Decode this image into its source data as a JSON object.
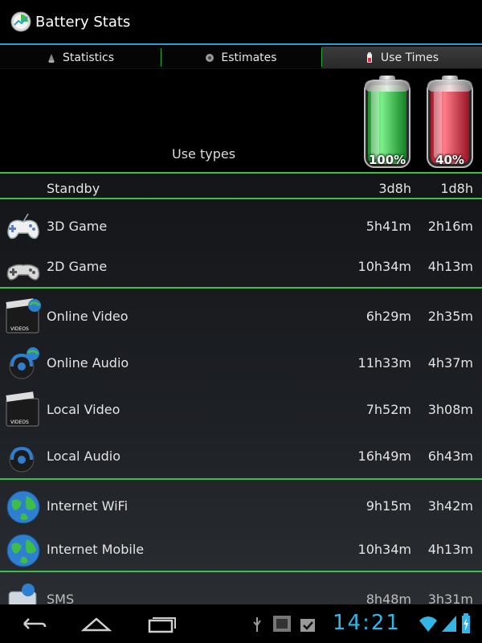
{
  "app": {
    "title": "Battery Stats"
  },
  "tabs": [
    {
      "label": "Statistics",
      "icon": "statistics-icon",
      "active": false
    },
    {
      "label": "Estimates",
      "icon": "estimates-icon",
      "active": false
    },
    {
      "label": "Use Times",
      "icon": "battery-icon",
      "active": true
    }
  ],
  "header": {
    "use_types_label": "Use types",
    "battery_full_pct": "100%",
    "battery_current_pct": "40%"
  },
  "rows": [
    {
      "label": "Standby",
      "full": "3d8h",
      "current": "1d8h"
    },
    {
      "label": "3D Game",
      "full": "5h41m",
      "current": "2h16m",
      "icon": "gamepad-icon"
    },
    {
      "label": "2D Game",
      "full": "10h34m",
      "current": "4h13m",
      "icon": "gamepad-icon"
    },
    {
      "label": "Online Video",
      "full": "6h29m",
      "current": "2h35m",
      "icon": "online-video-icon",
      "icon_text": "VIDEOS"
    },
    {
      "label": "Online Audio",
      "full": "11h33m",
      "current": "4h37m",
      "icon": "online-audio-icon"
    },
    {
      "label": "Local Video",
      "full": "7h52m",
      "current": "3h08m",
      "icon": "local-video-icon",
      "icon_text": "VIDEOS"
    },
    {
      "label": "Local Audio",
      "full": "16h49m",
      "current": "6h43m",
      "icon": "local-audio-icon"
    },
    {
      "label": "Internet WiFi",
      "full": "9h15m",
      "current": "3h42m",
      "icon": "globe-icon"
    },
    {
      "label": "Internet Mobile",
      "full": "10h34m",
      "current": "4h13m",
      "icon": "globe-icon"
    },
    {
      "label": "SMS",
      "full": "8h48m",
      "current": "3h31m",
      "icon": "sms-icon"
    }
  ],
  "statusbar": {
    "time": "14:21"
  },
  "colors": {
    "accent_blue": "#33b5e5",
    "divider_green": "#3fbd4a",
    "battery_green": "#2ecc40",
    "battery_red": "#e03040"
  }
}
